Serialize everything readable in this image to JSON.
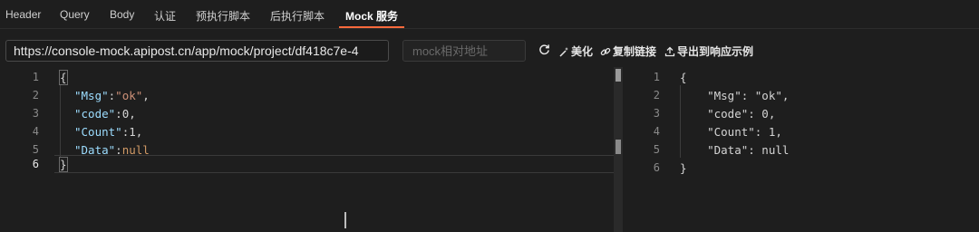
{
  "tabs": [
    {
      "label": "Header"
    },
    {
      "label": "Query"
    },
    {
      "label": "Body"
    },
    {
      "label": "认证"
    },
    {
      "label": "预执行脚本"
    },
    {
      "label": "后执行脚本"
    },
    {
      "label": "Mock 服务"
    }
  ],
  "active_tab": "Mock 服务",
  "url": {
    "value": "https://console-mock.apipost.cn/app/mock/project/df418c7e-4"
  },
  "mock_path": {
    "placeholder": "mock相对地址",
    "value": ""
  },
  "actions": {
    "refresh_icon": "refresh-icon",
    "beautify": "美化",
    "copy_link": "复制链接",
    "export": "导出到响应示例"
  },
  "left_editor": {
    "line_numbers": [
      "1",
      "2",
      "3",
      "4",
      "5",
      "6"
    ],
    "current_line": 6,
    "lines": {
      "l1": "{",
      "l2_key": "\"Msg\"",
      "l2_colon": ":",
      "l2_val": "\"ok\"",
      "l2_end": ",",
      "l3_key": "\"code\"",
      "l3_colon": ":",
      "l3_val": "0",
      "l3_end": ",",
      "l4_key": "\"Count\"",
      "l4_colon": ":",
      "l4_val": "1",
      "l4_end": ",",
      "l5_key": "\"Data\"",
      "l5_colon": ":",
      "l5_val": "null",
      "l6": "}"
    }
  },
  "right_editor": {
    "line_numbers": [
      "1",
      "2",
      "3",
      "4",
      "5",
      "6"
    ],
    "lines": [
      "{",
      "    \"Msg\": \"ok\",",
      "    \"code\": 0,",
      "    \"Count\": 1,",
      "    \"Data\": null",
      "}"
    ]
  },
  "colors": {
    "accent": "#ff6a3d",
    "background": "#1e1e1e",
    "key": "#9cdcfe",
    "string": "#ce9178"
  }
}
